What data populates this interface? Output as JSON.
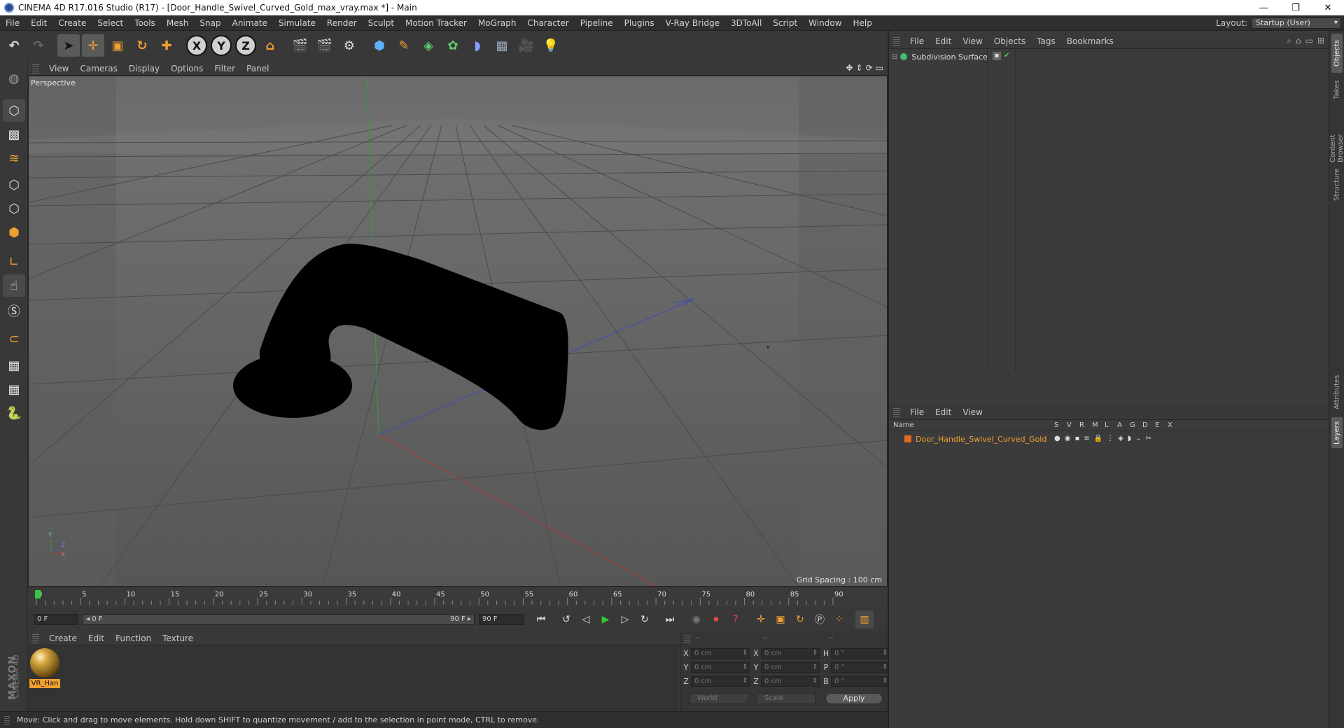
{
  "window": {
    "title": "CINEMA 4D R17.016 Studio (R17) - [Door_Handle_Swivel_Curved_Gold_max_vray.max *] - Main",
    "minimize": "—",
    "restore": "❐",
    "close": "✕"
  },
  "menubar": {
    "items": [
      "File",
      "Edit",
      "Create",
      "Select",
      "Tools",
      "Mesh",
      "Snap",
      "Animate",
      "Simulate",
      "Render",
      "Sculpt",
      "Motion Tracker",
      "MoGraph",
      "Character",
      "Pipeline",
      "Plugins",
      "V-Ray Bridge",
      "3DToAll",
      "Script",
      "Window",
      "Help"
    ],
    "layout_label": "Layout:",
    "layout_value": "Startup (User)"
  },
  "toolbar": {
    "icons": [
      "undo-icon",
      "redo-icon",
      "select-arrow-icon",
      "move-icon",
      "scale-icon",
      "rotate-icon",
      "move-alt-icon",
      "x-axis-icon",
      "y-axis-icon",
      "z-axis-icon",
      "coordinate-system-icon",
      "render-view-icon",
      "render-picture-viewer-icon",
      "render-settings-icon",
      "cube-icon",
      "pen-spline-icon",
      "subdivision-icon",
      "cloner-icon",
      "deformer-icon",
      "floor-icon",
      "camera-icon",
      "light-icon"
    ],
    "axis_x": "X",
    "axis_y": "Y",
    "axis_z": "Z"
  },
  "viewport": {
    "menu": [
      "View",
      "Cameras",
      "Display",
      "Options",
      "Filter",
      "Panel"
    ],
    "label": "Perspective",
    "grid_spacing": "Grid Spacing : 100 cm",
    "axis_labels": {
      "y": "Y",
      "x": "X",
      "z": "Z"
    }
  },
  "timeline": {
    "ticks": [
      "0",
      "5",
      "10",
      "15",
      "20",
      "25",
      "30",
      "35",
      "40",
      "45",
      "50",
      "55",
      "60",
      "65",
      "70",
      "75",
      "80",
      "85",
      "90"
    ],
    "current_frame": "0 F",
    "start_frame": "0 F",
    "range_start": "◂ 0 F",
    "range_end": "90 F ▸",
    "end_frame": "90 F"
  },
  "material_manager": {
    "menu": [
      "Create",
      "Edit",
      "Function",
      "Texture"
    ],
    "materials": [
      {
        "name": "VR_Han"
      }
    ]
  },
  "coordinates": {
    "header": [
      "--",
      "--",
      "--"
    ],
    "rows": [
      {
        "a": "X",
        "av": "0 cm",
        "b": "X",
        "bv": "0 cm",
        "c": "H",
        "cv": "0 °"
      },
      {
        "a": "Y",
        "av": "0 cm",
        "b": "Y",
        "bv": "0 cm",
        "c": "P",
        "cv": "0 °"
      },
      {
        "a": "Z",
        "av": "0 cm",
        "b": "Z",
        "bv": "0 cm",
        "c": "B",
        "cv": "0 °"
      }
    ],
    "mode1": "World",
    "mode2": "Scale",
    "apply": "Apply"
  },
  "objects_panel": {
    "menu": [
      "File",
      "Edit",
      "View",
      "Objects",
      "Tags",
      "Bookmarks"
    ],
    "items": [
      {
        "name": "Subdivision Surface"
      }
    ]
  },
  "layers_panel": {
    "menu": [
      "File",
      "Edit",
      "View"
    ],
    "columns": [
      "Name",
      "S",
      "V",
      "R",
      "M",
      "L",
      "A",
      "G",
      "D",
      "E",
      "X"
    ],
    "items": [
      {
        "name": "Door_Handle_Swivel_Curved_Gold"
      }
    ]
  },
  "side_tabs": [
    "Objects",
    "Takes",
    "Content Browser",
    "Structure",
    "Attributes",
    "Layers"
  ],
  "status": {
    "text": "Move: Click and drag to move elements. Hold down SHIFT to quantize movement / add to the selection in point mode, CTRL to remove."
  },
  "maxon_logo": {
    "line1": "MAXON",
    "line2": "CINEMA 4D"
  },
  "colors": {
    "accent_orange": "#f0a030",
    "accent_blue": "#5f8fd0"
  }
}
